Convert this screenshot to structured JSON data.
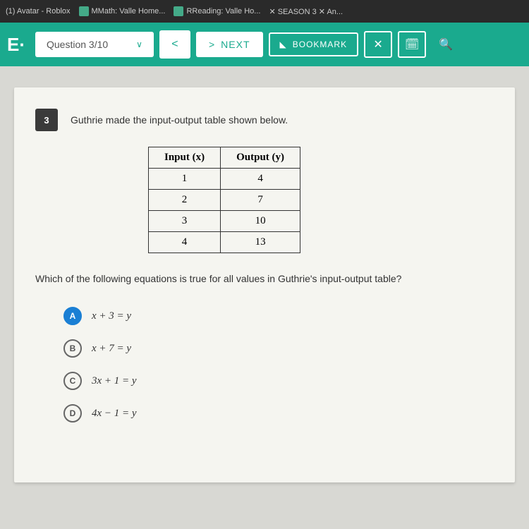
{
  "browser": {
    "tabs": [
      "(1) Avatar - Roblox",
      "MMath: Valle Home...",
      "RReading: Valle Ho...",
      "✕ SEASON 3 ✕ An..."
    ]
  },
  "appbar": {
    "logo": "E·",
    "question_indicator": "Question 3/10",
    "next_label": "NEXT",
    "bookmark_label": "BOOKMARK"
  },
  "question": {
    "number": "3",
    "prompt": "Guthrie made the input-output table shown below.",
    "sub_prompt": "Which of the following equations is true for all values in Guthrie's input-output table?",
    "table": {
      "headers": [
        "Input (x)",
        "Output (y)"
      ],
      "rows": [
        [
          "1",
          "4"
        ],
        [
          "2",
          "7"
        ],
        [
          "3",
          "10"
        ],
        [
          "4",
          "13"
        ]
      ]
    },
    "options": [
      {
        "letter": "A",
        "text": "x + 3 = y",
        "selected": true
      },
      {
        "letter": "B",
        "text": "x + 7 = y",
        "selected": false
      },
      {
        "letter": "C",
        "text": "3x + 1 = y",
        "selected": false
      },
      {
        "letter": "D",
        "text": "4x − 1 = y",
        "selected": false
      }
    ]
  }
}
